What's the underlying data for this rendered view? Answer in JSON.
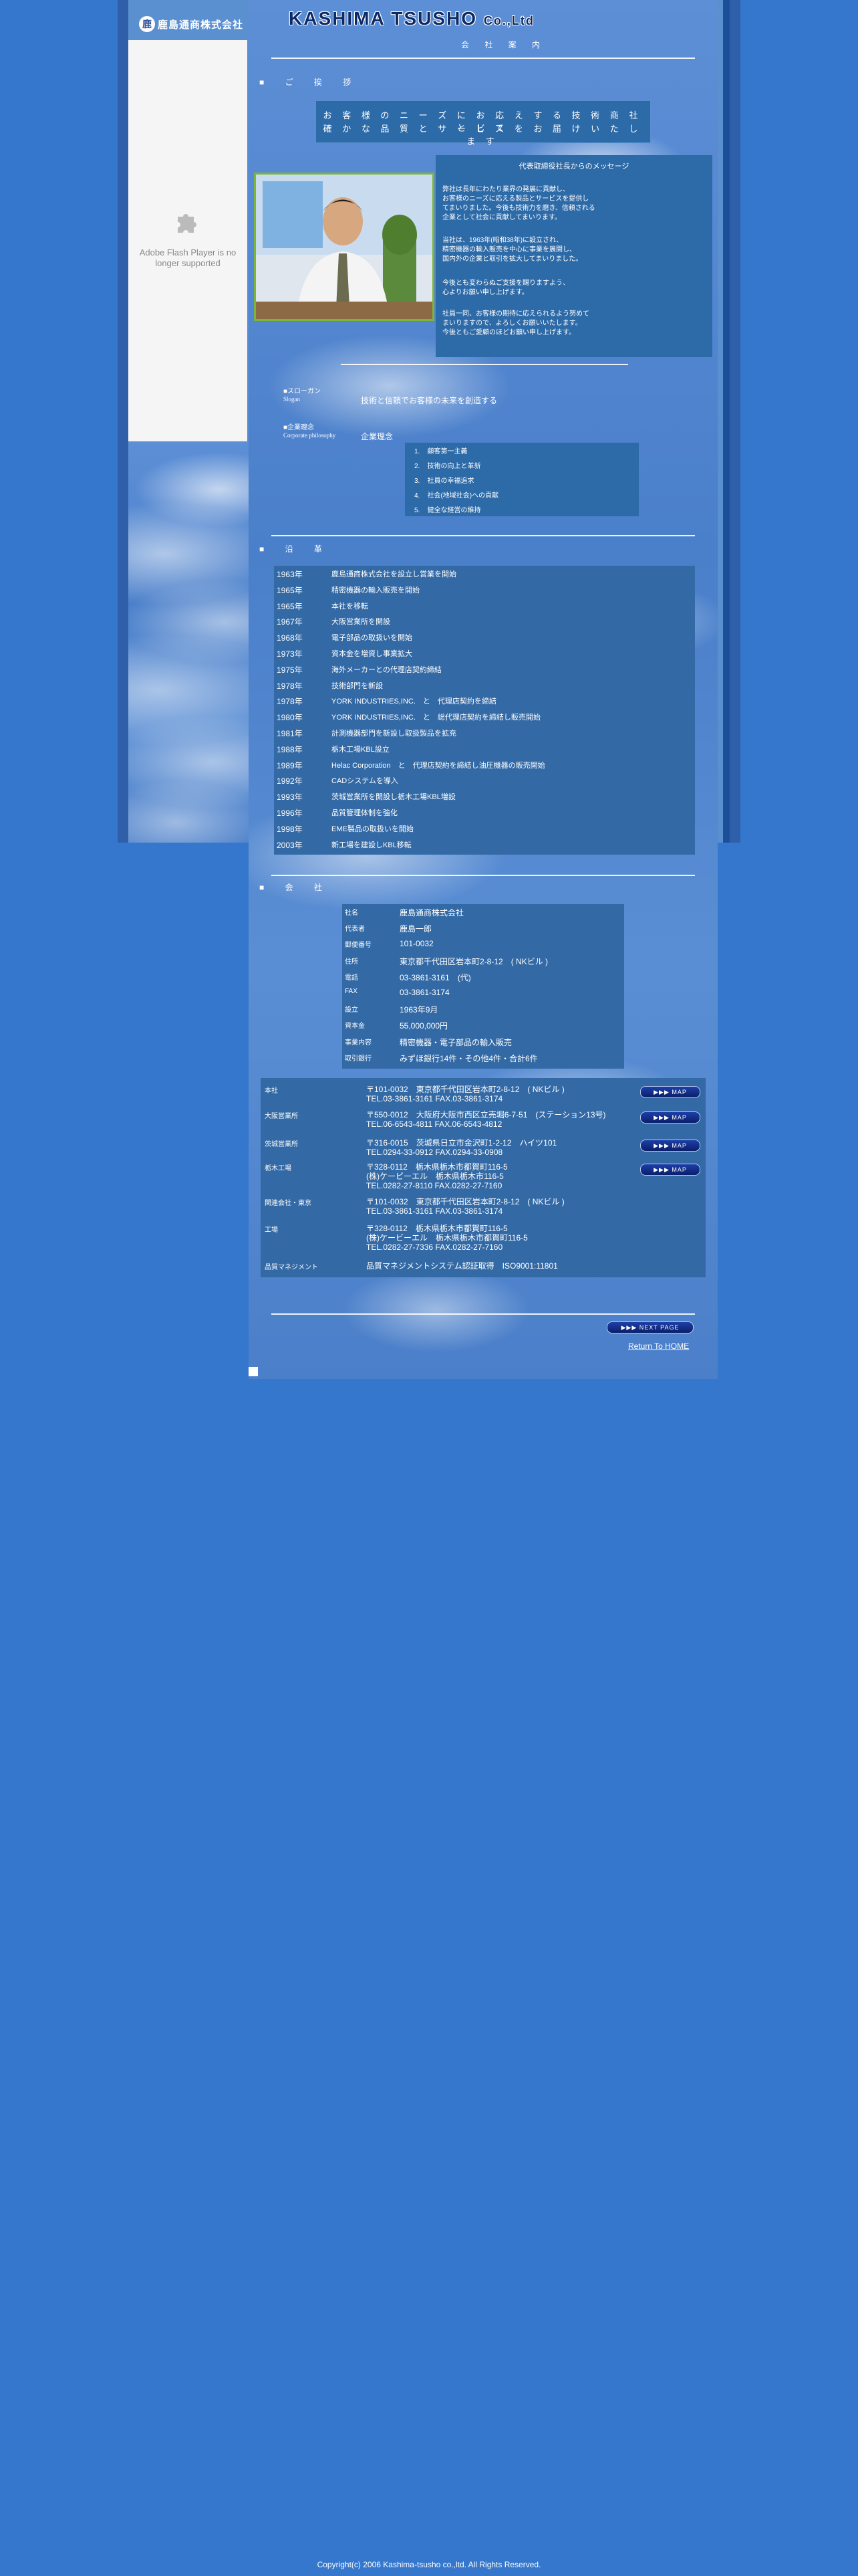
{
  "header": {
    "logo_mark": "鹿",
    "logo_text": "鹿島通商株式会社",
    "title": "KASHIMA TSUSHO",
    "title_suffix": "Co.,Ltd",
    "subtitle": "会 社 案 内"
  },
  "flash": {
    "message": "Adobe Flash Player is no longer supported",
    "icon": "puzzle-piece-icon"
  },
  "nav": {
    "greeting_heading": "■ ご 挨 拶"
  },
  "greeting": {
    "line1": "お 客 様 の ニ ー ズ に お 応 え す る 技 術 商 社 と し て",
    "line2": "確 か な 品 質 と サ ー ビ ス を お 届 け い た し ま す"
  },
  "message": {
    "title": "代表取締役社長からのメッセージ",
    "lines": [
      "弊社は長年にわたり業界の発展に貢献し、",
      "お客様のニーズに応える製品とサービスを提供し",
      "てまいりました。今後も技術力を磨き、信頼される",
      "企業として社会に貢献してまいります。",
      "",
      "当社は、1963年(昭和38年)に設立され、",
      "精密機器の輸入販売を中心に事業を展開し、",
      "国内外の企業と取引を拡大してまいりました。",
      "",
      "今後とも変わらぬご支援を賜りますよう、",
      "心よりお願い申し上げます。",
      "",
      "社員一同、お客様の期待に応えられるよう努めて",
      "まいりますので、よろしくお願いいたします。",
      "今後ともご愛顧のほどお願い申し上げます。"
    ]
  },
  "slogan": {
    "label_jp": "■スローガン",
    "label_en": "Slogan",
    "text": "技術と信頼でお客様の未来を創造する"
  },
  "philosophy": {
    "label_jp": "■企業理念",
    "label_en": "Corporate philosophy",
    "text": "企業理念",
    "items": [
      "顧客第一主義",
      "技術の向上と革新",
      "社員の幸福追求",
      "社会(地域社会)への貢献",
      "健全な経営の維持"
    ]
  },
  "history": {
    "heading": "■ 沿 革",
    "rows": [
      {
        "year": "1963年",
        "event": "鹿島通商株式会社を設立し営業を開始"
      },
      {
        "year": "1965年",
        "event": "精密機器の輸入販売を開始"
      },
      {
        "year": "1965年",
        "event": "本社を移転"
      },
      {
        "year": "1967年",
        "event": "大阪営業所を開設"
      },
      {
        "year": "1968年",
        "event": "電子部品の取扱いを開始"
      },
      {
        "year": "1973年",
        "event": "資本金を増資し事業拡大"
      },
      {
        "year": "1975年",
        "event": "海外メーカーとの代理店契約締結"
      },
      {
        "year": "1978年",
        "event": "技術部門を新設"
      },
      {
        "year": "1978年",
        "event": "YORK INDUSTRIES,INC.　と　代理店契約を締結"
      },
      {
        "year": "1980年",
        "event": "YORK INDUSTRIES,INC.　と　総代理店契約を締結し販売開始"
      },
      {
        "year": "1981年",
        "event": "計測機器部門を新設し取扱製品を拡充"
      },
      {
        "year": "1988年",
        "event": "栃木工場KBL設立"
      },
      {
        "year": "1989年",
        "event": "Helac Corporation　と　代理店契約を締結し油圧機器の販売開始"
      },
      {
        "year": "1992年",
        "event": "CADシステムを導入"
      },
      {
        "year": "1993年",
        "event": "茨城営業所を開設し栃木工場KBL増設"
      },
      {
        "year": "1996年",
        "event": "品質管理体制を強化"
      },
      {
        "year": "1998年",
        "event": "EME製品の取扱いを開始"
      },
      {
        "year": "2003年",
        "event": "新工場を建設しKBL移転"
      }
    ]
  },
  "company": {
    "heading": "■ 会 社",
    "rows": [
      {
        "key": "社名",
        "value": "鹿島通商株式会社"
      },
      {
        "key": "代表者",
        "value": "鹿島一郎"
      },
      {
        "key": "郵便番号",
        "value": "101-0032"
      },
      {
        "key": "住所",
        "value": "東京都千代田区岩本町2-8-12　( NKビル )"
      },
      {
        "key": "電話",
        "value": "03-3861-3161　(代)"
      },
      {
        "key": "FAX",
        "value": "03-3861-3174"
      },
      {
        "key": "設立",
        "value": "1963年9月"
      },
      {
        "key": "資本金",
        "value": "55,000,000円"
      },
      {
        "key": "事業内容",
        "value": "精密機器・電子部品の輸入販売"
      },
      {
        "key": "取引銀行",
        "value": "みずほ銀行14件・その他4件・合計6件"
      }
    ]
  },
  "offices": {
    "rows": [
      {
        "key": "本社",
        "lines": [
          "〒101-0032　東京都千代田区岩本町2-8-12　( NKビル )",
          "TEL.03-3861-3161 FAX.03-3861-3174"
        ],
        "map": true
      },
      {
        "key": "大阪営業所",
        "lines": [
          "〒550-0012　大阪府大阪市西区立売堀6-7-51　(ステーション13号)",
          "TEL.06-6543-4811 FAX.06-6543-4812"
        ],
        "map": true
      },
      {
        "key": "茨城営業所",
        "lines": [
          "〒316-0015　茨城県日立市金沢町1-2-12　ハイツ101",
          "TEL.0294-33-0912 FAX.0294-33-0908"
        ],
        "map": true
      },
      {
        "key": "栃木工場",
        "lines": [
          "〒328-0112　栃木県栃木市都賀町116-5",
          "(株)ケービーエル　栃木県栃木市116-5",
          "TEL.0282-27-8110 FAX.0282-27-7160"
        ],
        "map": true
      },
      {
        "key": "関連会社・東京",
        "lines": [
          "〒101-0032　東京都千代田区岩本町2-8-12　( NKビル )",
          "TEL.03-3861-3161 FAX.03-3861-3174"
        ],
        "map": false
      },
      {
        "key": "工場",
        "lines": [
          "〒328-0112　栃木県栃木市都賀町116-5",
          "(株)ケービーエル　栃木県栃木市都賀町116-5",
          "TEL.0282-27-7336 FAX.0282-27-7160"
        ],
        "map": false
      },
      {
        "key": "品質マネジメント",
        "lines": [
          "品質マネジメントシステム認証取得　ISO9001:11801"
        ],
        "map": false
      }
    ],
    "map_label": "▶▶▶ MAP"
  },
  "footer": {
    "next_label": "▶▶▶ NEXT PAGE",
    "return_label": "Return To HOME",
    "copyright": "Copyright(c) 2006 Kashima-tsusho co.,ltd. All Rights Reserved."
  }
}
